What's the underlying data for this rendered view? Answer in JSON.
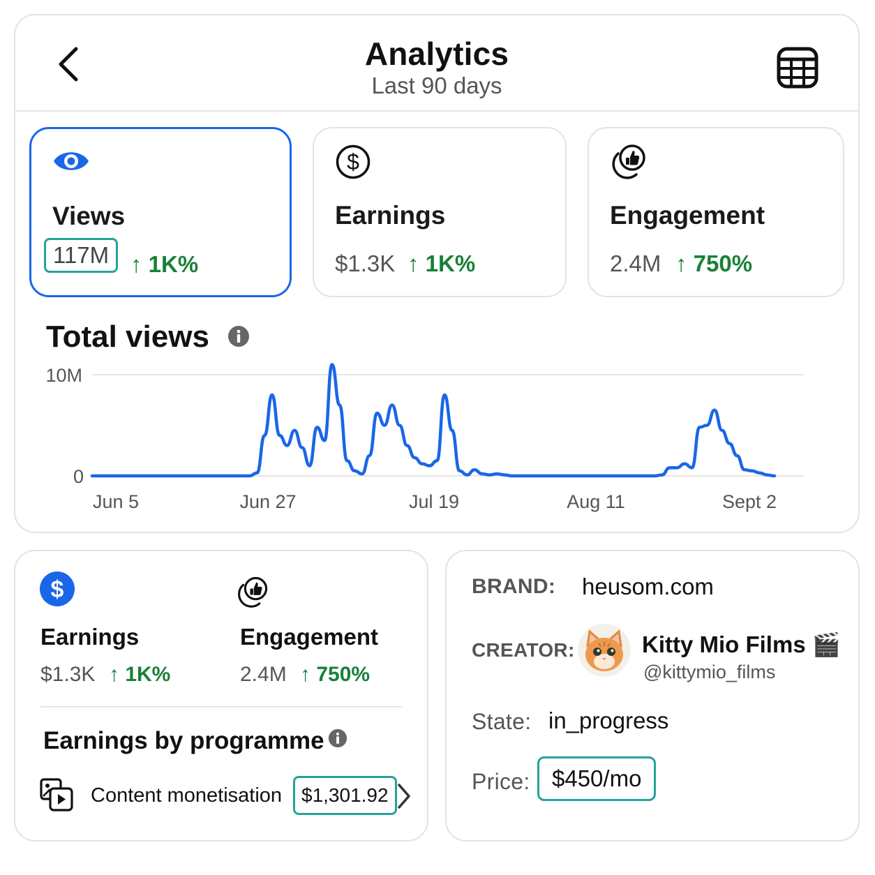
{
  "header": {
    "title": "Analytics",
    "subtitle": "Last 90 days",
    "back_icon": "chevron-left-icon",
    "table_icon": "table-icon"
  },
  "metrics": [
    {
      "label": "Views",
      "value": "117M",
      "delta": "↑ 1K%",
      "icon": "eye-icon",
      "selected": true
    },
    {
      "label": "Earnings",
      "value": "$1.3K",
      "delta": "↑ 1K%",
      "icon": "dollar-circle-icon",
      "selected": false
    },
    {
      "label": "Engagement",
      "value": "2.4M",
      "delta": "↑ 750%",
      "icon": "thumbs-up-icon",
      "selected": false
    }
  ],
  "chart": {
    "title": "Total views"
  },
  "chart_data": {
    "type": "line",
    "title": "Total views",
    "xlabel": "",
    "ylabel": "",
    "x_tick_labels": [
      "Jun 5",
      "Jun 27",
      "Jul 19",
      "Aug 11",
      "Sept 2"
    ],
    "y_tick_labels": [
      "10M",
      "0"
    ],
    "ylim": [
      0,
      10
    ],
    "y_unit": "M",
    "grid": true,
    "color": "#1a66e8",
    "series": [
      {
        "values": [
          0,
          0,
          0,
          0,
          0,
          0,
          0,
          0,
          0,
          0,
          0,
          0,
          0,
          0,
          0,
          0,
          0,
          0,
          0,
          0,
          0,
          0,
          0.3,
          4.0,
          8.0,
          4.0,
          3.0,
          4.5,
          2.8,
          1.0,
          4.8,
          3.5,
          11.0,
          7.0,
          1.5,
          0.5,
          0.2,
          2.0,
          6.2,
          5.0,
          7.0,
          5.0,
          3.0,
          1.8,
          1.2,
          1.0,
          1.5,
          8.0,
          4.5,
          0.5,
          0.1,
          0.6,
          0.2,
          0.1,
          0.2,
          0.1,
          0,
          0,
          0,
          0,
          0,
          0,
          0,
          0,
          0,
          0,
          0,
          0,
          0,
          0,
          0,
          0,
          0,
          0,
          0,
          0,
          0.1,
          0.8,
          0.8,
          1.2,
          0.8,
          4.8,
          5.0,
          6.5,
          4.5,
          3.2,
          2.0,
          0.6,
          0.5,
          0.3,
          0.1,
          0
        ]
      }
    ]
  },
  "earnings_panel": {
    "earnings": {
      "label": "Earnings",
      "value": "$1.3K",
      "delta": "↑ 1K%",
      "icon": "dollar-filled-icon",
      "accent": "#1a66e8"
    },
    "engagement": {
      "label": "Engagement",
      "value": "2.4M",
      "delta": "↑ 750%",
      "icon": "thumbs-up-icon"
    },
    "section_title": "Earnings by programme",
    "programme": {
      "label": "Content monetisation",
      "amount": "$1,301.92",
      "icon": "content-monetisation-icon"
    }
  },
  "brand_panel": {
    "brand_label": "BRAND:",
    "brand_value": "heusom.com",
    "creator_label": "CREATOR:",
    "creator_name": "Kitty Mio Films",
    "creator_emoji": "🎬",
    "creator_handle": "@kittymio_films",
    "state_label": "State:",
    "state_value": "in_progress",
    "price_label": "Price:",
    "price_value": "$450/mo"
  },
  "colors": {
    "accent": "#1a66e8",
    "positive": "#188038",
    "highlight_border": "#25a39a"
  }
}
